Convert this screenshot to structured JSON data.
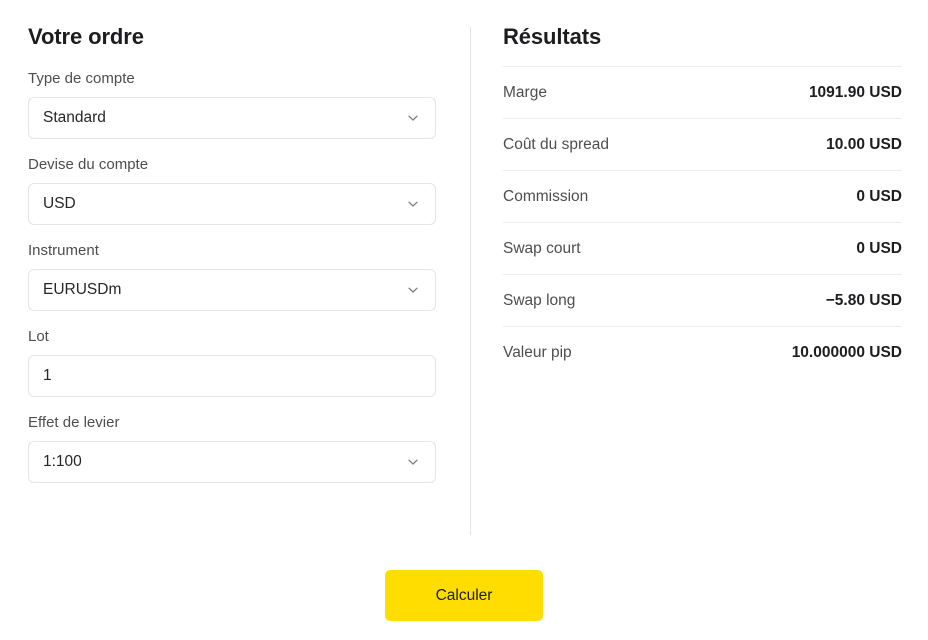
{
  "order_panel": {
    "heading": "Votre ordre",
    "fields": [
      {
        "label": "Type de compte",
        "value": "Standard",
        "control": "select",
        "icon": "chevron-down-icon",
        "name": "account-type"
      },
      {
        "label": "Devise du compte",
        "value": "USD",
        "control": "select",
        "icon": "chevron-down-icon",
        "name": "account-currency"
      },
      {
        "label": "Instrument",
        "value": "EURUSDm",
        "control": "select",
        "icon": "chevron-down-icon",
        "name": "instrument"
      },
      {
        "label": "Lot",
        "value": "1",
        "control": "text",
        "icon": "",
        "name": "lot"
      },
      {
        "label": "Effet de levier",
        "value": "1:100",
        "control": "select",
        "icon": "chevron-down-icon",
        "name": "leverage"
      }
    ]
  },
  "results_panel": {
    "heading": "Résultats",
    "rows": [
      {
        "label": "Marge",
        "value": "1091.90 USD"
      },
      {
        "label": "Coût du spread",
        "value": "10.00 USD"
      },
      {
        "label": "Commission",
        "value": "0 USD"
      },
      {
        "label": "Swap court",
        "value": "0 USD"
      },
      {
        "label": "Swap long",
        "value": "−5.80 USD"
      },
      {
        "label": "Valeur pip",
        "value": "10.000000 USD"
      }
    ]
  },
  "action": {
    "calculate_label": "Calculer"
  },
  "colors": {
    "accent": "#ffdd00",
    "text_primary": "#1d1d1f",
    "text_secondary": "#4e4e51",
    "border": "#e4e5e7",
    "row_border": "#eceded",
    "divider": "#e2e3e5",
    "background": "#ffffff"
  }
}
